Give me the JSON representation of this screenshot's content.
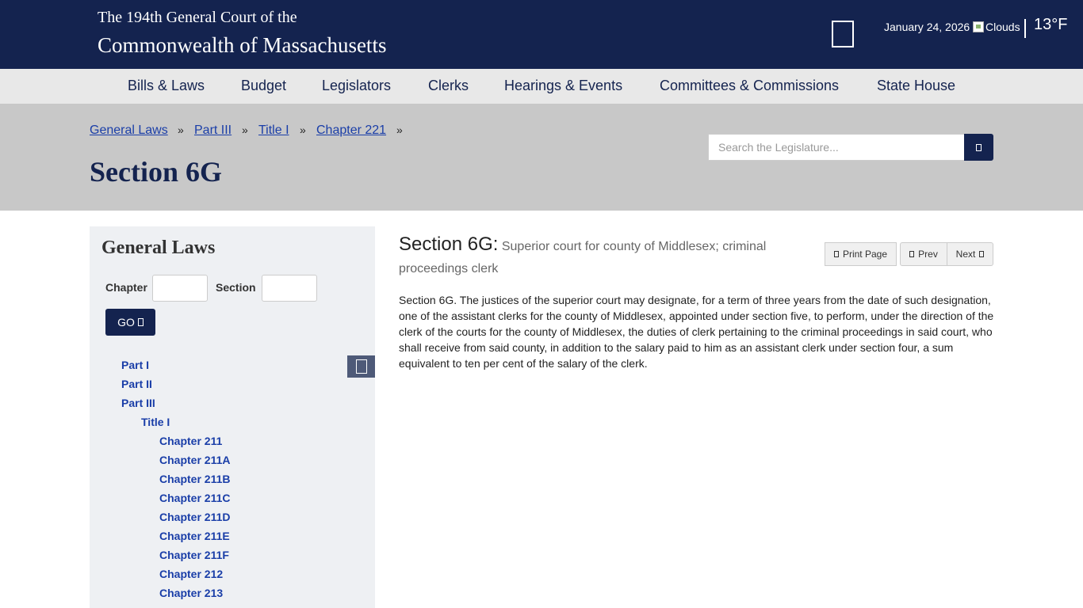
{
  "header": {
    "title_line1": "The 194th General Court of the",
    "title_line2": "Commonwealth of Massachusetts",
    "date": "January 24, 2026",
    "weather_alt": "Clouds",
    "divider": "|",
    "temperature": "13°F",
    "menu_icon": "menu-icon"
  },
  "nav": {
    "items": [
      "Bills & Laws",
      "Budget",
      "Legislators",
      "Clerks",
      "Hearings & Events",
      "Committees & Commissions",
      "State House"
    ]
  },
  "breadcrumb": {
    "items": [
      "General Laws",
      "Part III",
      "Title I",
      "Chapter 221"
    ],
    "separator": "»"
  },
  "page": {
    "title": "Section 6G"
  },
  "search": {
    "placeholder": "Search the Legislature...",
    "icon": "search-icon"
  },
  "sidebar": {
    "title": "General Laws",
    "chapter_label": "Chapter",
    "section_label": "Section",
    "chapter_value": "",
    "section_value": "",
    "go_label": "GO",
    "tree": {
      "parts": [
        "Part I",
        "Part II",
        "Part III"
      ],
      "title": "Title I",
      "chapters": [
        "Chapter 211",
        "Chapter 211A",
        "Chapter 211B",
        "Chapter 211C",
        "Chapter 211D",
        "Chapter 211E",
        "Chapter 211F",
        "Chapter 212",
        "Chapter 213"
      ]
    }
  },
  "content": {
    "section_number": "Section 6G:",
    "section_caption": "Superior court for county of Middlesex; criminal proceedings clerk",
    "print_label": "Print Page",
    "prev_label": "Prev",
    "next_label": "Next",
    "body": "Section 6G. The justices of the superior court may designate, for a term of three years from the date of such designation, one of the assistant clerks for the county of Middlesex, appointed under section five, to perform, under the direction of the clerk of the courts for the county of Middlesex, the duties of clerk pertaining to the criminal proceedings in said court, who shall receive from said county, in addition to the salary paid to him as an assistant clerk under section four, a sum equivalent to ten per cent of the salary of the clerk."
  }
}
